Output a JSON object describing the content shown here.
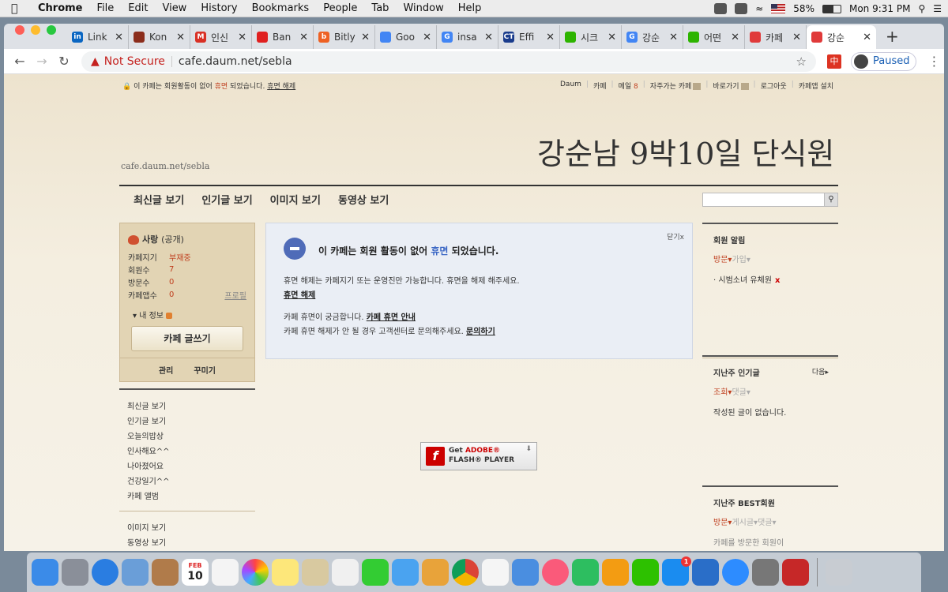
{
  "menubar": {
    "app": "Chrome",
    "items": [
      "File",
      "Edit",
      "View",
      "History",
      "Bookmarks",
      "People",
      "Tab",
      "Window",
      "Help"
    ],
    "battery": "58%",
    "clock": "Mon 9:31 PM"
  },
  "tabs": [
    {
      "label": "Link",
      "fav_color": "#0a66c2",
      "fav_text": "in"
    },
    {
      "label": "Kon",
      "fav_color": "#8b2d1c",
      "fav_text": ""
    },
    {
      "label": "인신",
      "fav_color": "#d93025",
      "fav_text": "M"
    },
    {
      "label": "Ban",
      "fav_color": "#e02020",
      "fav_text": ""
    },
    {
      "label": "Bitly",
      "fav_color": "#ee6123",
      "fav_text": "b"
    },
    {
      "label": "Goo",
      "fav_color": "#4285f4",
      "fav_text": ""
    },
    {
      "label": "insa",
      "fav_color": "#4285f4",
      "fav_text": "G"
    },
    {
      "label": "Effi",
      "fav_color": "#1a3c8c",
      "fav_text": "CT"
    },
    {
      "label": "시크",
      "fav_color": "#2db400",
      "fav_text": ""
    },
    {
      "label": "강순",
      "fav_color": "#4285f4",
      "fav_text": "G"
    },
    {
      "label": "어떤",
      "fav_color": "#2db400",
      "fav_text": ""
    },
    {
      "label": "카페",
      "fav_color": "#e03a3a",
      "fav_text": ""
    },
    {
      "label": "강순",
      "fav_color": "#e03a3a",
      "fav_text": "",
      "active": true
    }
  ],
  "toolbar": {
    "security": "Not Secure",
    "url": "cafe.daum.net/sebla",
    "profile_status": "Paused"
  },
  "page": {
    "dormant_notice": {
      "pre": "이 카페는 회원활동이 없어 ",
      "keyword": "휴면",
      "post": " 되었습니다.",
      "link": "휴면 해제"
    },
    "topnav": {
      "daum": "Daum",
      "cafe": "카페",
      "mail": "메일",
      "mail_count": "8",
      "frequent": "자주가는 카페",
      "shortcut": "바로가기",
      "logout": "로그아웃",
      "app_install": "카페앱 설치"
    },
    "cafe_url": "cafe.daum.net/sebla",
    "cafe_title": "강순남 9박10일 단식원",
    "main_menu": [
      "최신글 보기",
      "인기글 보기",
      "이미지 보기",
      "동영상 보기"
    ],
    "profile": {
      "grade": "사랑",
      "visibility": "(공개)",
      "stats": [
        {
          "key": "카페지기",
          "value": "부재중"
        },
        {
          "key": "회원수",
          "value": "7"
        },
        {
          "key": "방문수",
          "value": "0"
        },
        {
          "key": "카페앱수",
          "value": "0"
        }
      ],
      "profile_link": "프로필",
      "my_info": "내 정보",
      "write_button": "카페 글쓰기",
      "manage": "관리",
      "decorate": "꾸미기"
    },
    "left_menu": {
      "group1": [
        "최신글 보기",
        "인기글 보기",
        "오늘의밥상",
        "인사해요^^",
        "나아졌어요",
        "건강일기^^",
        "카페 앨범"
      ],
      "group2": [
        "이미지 보기",
        "동영상 보기"
      ]
    },
    "notice": {
      "close": "닫기",
      "head_pre": "이 카페는 회원 활동이 없어 ",
      "head_keyword": "휴면",
      "head_post": " 되었습니다.",
      "line1": "휴면 해제는 카페지기 또는 운영진만 가능합니다. 휴면을 해제 해주세요.",
      "link1": "휴면 해제",
      "line2": "카페 휴면이 궁금합니다.",
      "link2": "카페 휴면 안내",
      "line3": "카페 휴면 해제가 안 될 경우 고객센터로 문의해주세요.",
      "link3": "문의하기"
    },
    "flash": {
      "get": "Get ",
      "adobe": "ADOBE®",
      "player": "FLASH® PLAYER"
    },
    "right": {
      "member_alert": {
        "title": "회원 알림",
        "tab_on": "방문",
        "tab_off": "가입",
        "item": "시범소녀 유체원"
      },
      "popular": {
        "title": "지난주 인기글",
        "more": "다음",
        "tab_on": "조회",
        "tab_off": "댓글",
        "empty": "작성된 글이 없습니다."
      },
      "best": {
        "title": "지난주 BEST회원",
        "tab_on": "방문",
        "tab_off1": "게시글",
        "tab_off2": "댓글",
        "body": "카페를 방문한 회원이"
      }
    }
  },
  "dock": {
    "calendar_month": "FEB",
    "calendar_day": "10",
    "appstore_badge": "1"
  }
}
